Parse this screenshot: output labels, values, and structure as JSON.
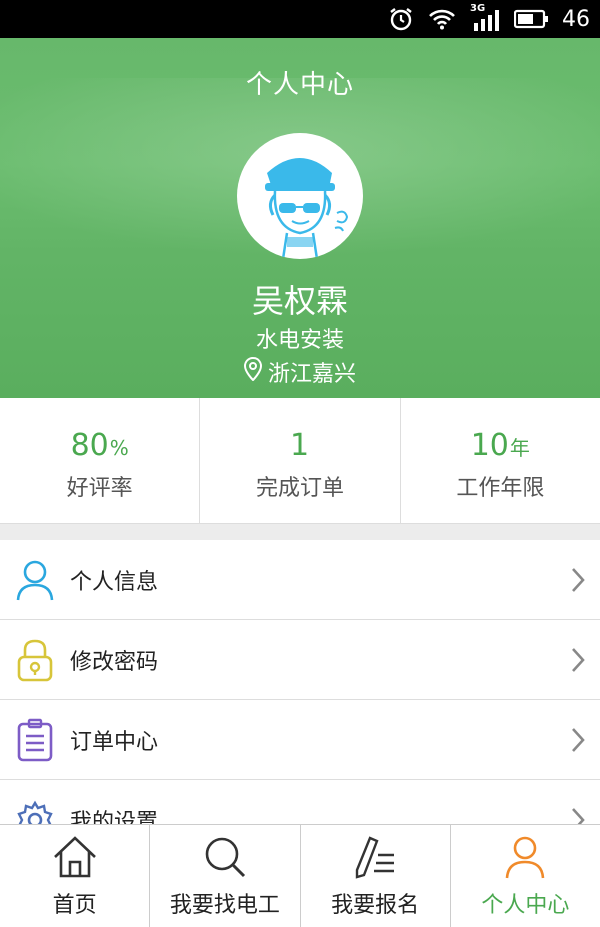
{
  "status_bar": {
    "battery_level": "46",
    "network_type": "3G",
    "icons": [
      "alarm-icon",
      "wifi-icon",
      "signal-icon",
      "battery-icon"
    ]
  },
  "header": {
    "title": "个人中心",
    "name": "吴权霖",
    "occupation": "水电安装",
    "location": "浙江嘉兴"
  },
  "stats": [
    {
      "value": "80",
      "unit": "%",
      "label": "好评率"
    },
    {
      "value": "1",
      "unit": "",
      "label": "完成订单"
    },
    {
      "value": "10",
      "unit": "年",
      "label": "工作年限"
    }
  ],
  "menu": [
    {
      "label": "个人信息",
      "icon": "user-icon"
    },
    {
      "label": "修改密码",
      "icon": "lock-icon"
    },
    {
      "label": "订单中心",
      "icon": "clipboard-icon"
    },
    {
      "label": "我的设置",
      "icon": "gear-icon"
    }
  ],
  "tabs": [
    {
      "label": "首页",
      "icon": "home-icon",
      "active": false
    },
    {
      "label": "我要找电工",
      "icon": "search-icon",
      "active": false
    },
    {
      "label": "我要报名",
      "icon": "edit-icon",
      "active": false
    },
    {
      "label": "个人中心",
      "icon": "user-icon",
      "active": true
    }
  ],
  "colors": {
    "accent": "#4aa84f",
    "header_bg": "#65b769",
    "active_tab_icon": "#f08a2a",
    "user_icon": "#2aa7df",
    "lock_icon": "#d7c53a",
    "clipboard_icon": "#7d5cc6",
    "gear_icon": "#4d6fb8"
  }
}
